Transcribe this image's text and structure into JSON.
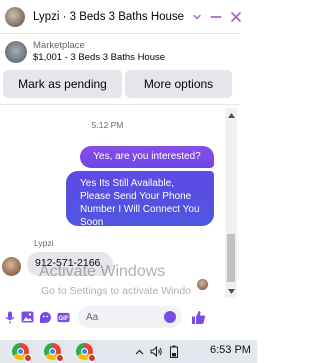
{
  "header": {
    "title": "Lypzi · 3 Beds 3 Baths House",
    "accent_color": "#a56ac8",
    "icons": [
      "chevron-down-icon",
      "minimize-icon",
      "close-icon"
    ]
  },
  "listing": {
    "source": "Marketplace",
    "price_title": "$1,001 - 3 Beds 3 Baths House"
  },
  "actions": {
    "pending_label": "Mark as pending",
    "more_label": "More options"
  },
  "thread": {
    "timestamp": "5:12 PM",
    "messages": [
      {
        "from": "me",
        "text": "Yes, are you interested?"
      },
      {
        "from": "me",
        "text": "Yes Its Still Available, Please Send Your Phone Number I Will Connect You Soon"
      },
      {
        "from": "Lypzi",
        "text": "912-571-2166"
      }
    ],
    "sender_name": "Lypzi",
    "bubble_color": "#7b4be8",
    "bubble_color_2": "#4d56e0"
  },
  "composer": {
    "placeholder": "Aa",
    "icons": [
      "microphone-icon",
      "image-icon",
      "sticker-icon",
      "gif-icon",
      "emoji-icon",
      "like-icon"
    ],
    "gif_label": "GIF"
  },
  "watermark": {
    "line1": "Activate Windows",
    "line2": "Go to Settings to activate Windo"
  },
  "taskbar": {
    "apps": [
      "chrome-icon",
      "chrome-icon",
      "chrome-icon"
    ],
    "tray": {
      "chevron": "^",
      "time": "6:53 PM"
    }
  }
}
